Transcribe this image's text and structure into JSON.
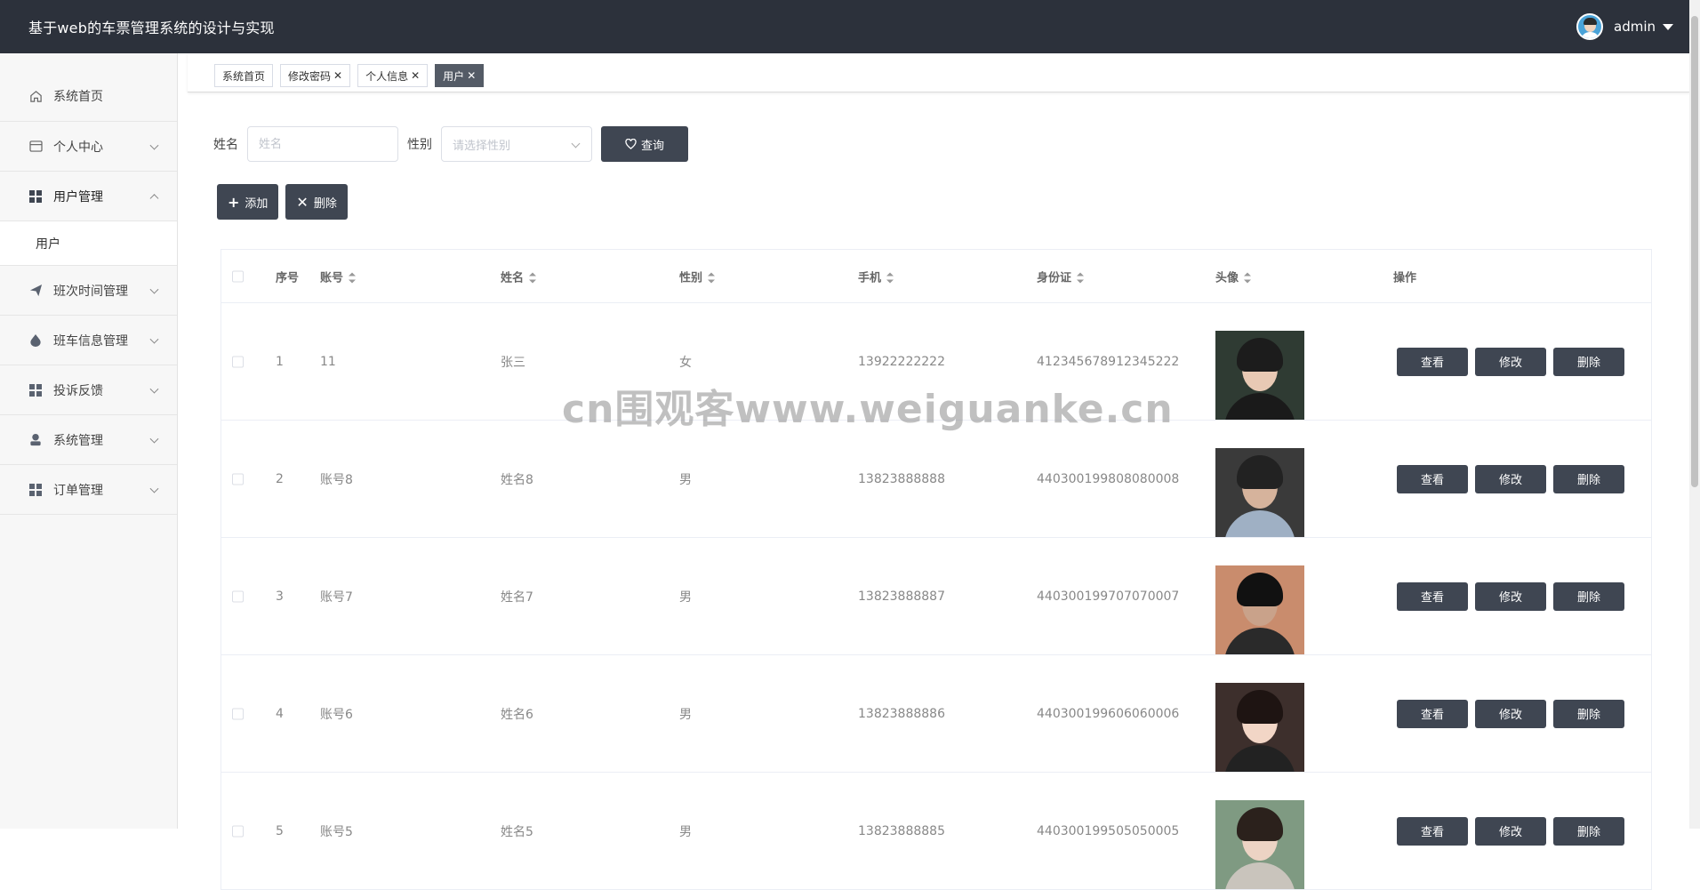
{
  "header": {
    "title": "基于web的车票管理系统的设计与实现",
    "user": "admin"
  },
  "sidebar": {
    "items": [
      {
        "label": "系统首页",
        "icon": "home-icon"
      },
      {
        "label": "个人中心",
        "icon": "card-icon"
      },
      {
        "label": "用户管理",
        "icon": "grid-icon",
        "expanded": true,
        "children": [
          "用户"
        ]
      },
      {
        "label": "班次时间管理",
        "icon": "send-icon"
      },
      {
        "label": "班车信息管理",
        "icon": "drop-icon"
      },
      {
        "label": "投诉反馈",
        "icon": "grid-icon"
      },
      {
        "label": "系统管理",
        "icon": "person-icon"
      },
      {
        "label": "订单管理",
        "icon": "grid-icon"
      }
    ]
  },
  "tabs": [
    {
      "label": "系统首页",
      "closable": false
    },
    {
      "label": "修改密码",
      "closable": true
    },
    {
      "label": "个人信息",
      "closable": true
    },
    {
      "label": "用户",
      "closable": true,
      "active": true
    }
  ],
  "search": {
    "name_label": "姓名",
    "name_placeholder": "姓名",
    "gender_label": "性别",
    "gender_placeholder": "请选择性别",
    "query_button": "查询"
  },
  "actions": {
    "add": "添加",
    "delete": "删除"
  },
  "table": {
    "headers": [
      "序号",
      "账号",
      "姓名",
      "性别",
      "手机",
      "身份证",
      "头像",
      "操作"
    ],
    "op_labels": [
      "查看",
      "修改",
      "删除"
    ],
    "rows": [
      {
        "index": "1",
        "account": "11",
        "name": "张三",
        "gender": "女",
        "phone": "13922222222",
        "id_card": "412345678912345222",
        "avatar": "woman-short-hair"
      },
      {
        "index": "2",
        "account": "账号8",
        "name": "姓名8",
        "gender": "男",
        "phone": "13823888888",
        "id_card": "440300199808080008",
        "avatar": "young-man"
      },
      {
        "index": "3",
        "account": "账号7",
        "name": "姓名7",
        "gender": "男",
        "phone": "13823888887",
        "id_card": "440300199707070007",
        "avatar": "man-sitting"
      },
      {
        "index": "4",
        "account": "账号6",
        "name": "姓名6",
        "gender": "男",
        "phone": "13823888886",
        "id_card": "440300199606060006",
        "avatar": "smiling-girl"
      },
      {
        "index": "5",
        "account": "账号5",
        "name": "姓名5",
        "gender": "男",
        "phone": "13823888885",
        "id_card": "440300199505050005",
        "avatar": "girl-outdoor"
      }
    ]
  },
  "watermark": "cn围观客www.weiguanke.cn",
  "colors": {
    "header_bg": "#2c313b",
    "button_dark": "#3f4652",
    "active_tab": "#545b66"
  }
}
